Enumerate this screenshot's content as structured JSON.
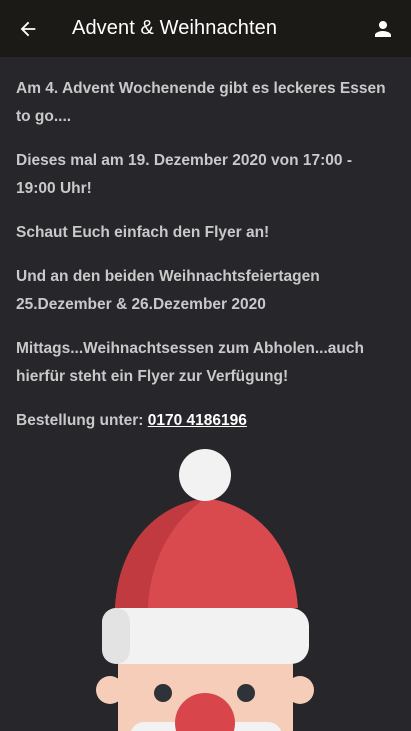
{
  "header": {
    "title": "Advent & Weihnachten",
    "back_icon": "arrow-left-icon",
    "account_icon": "person-icon"
  },
  "content": {
    "paragraphs": [
      "Am 4. Advent Wochenende gibt es leckeres Essen to go....",
      "Dieses mal am 19. Dezember 2020 von 17:00 - 19:00 Uhr!",
      "Schaut Euch einfach den Flyer an!",
      "Und an den beiden Weihnachtsfeiertagen 25.Dezember & 26.Dezember 2020",
      "Mittags...Weihnachtsessen zum Abholen...auch hierfür steht ein Flyer zur Verfügung!"
    ],
    "order_label": "Bestellung unter: ",
    "phone": "0170 4186196"
  },
  "colors": {
    "appbar": "#1b1a17",
    "background": "#26262b",
    "text": "#c9c9c9",
    "hat_red": "#d84a4e",
    "hat_shadow": "#c13a3f",
    "fur_white": "#f2f2f2",
    "skin": "#f5cdb8",
    "nose": "#d8454a"
  }
}
